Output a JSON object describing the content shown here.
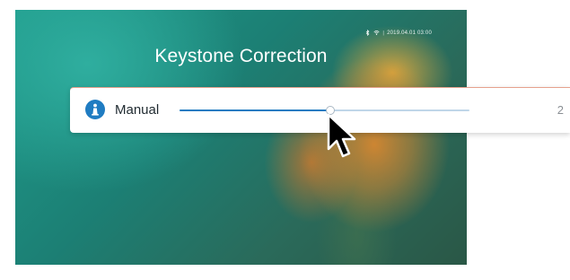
{
  "status_bar": {
    "bluetooth_icon": "bluetooth-icon",
    "wifi_icon": "wifi-icon",
    "separator": "|",
    "datetime": "2019.04.01 03:00"
  },
  "title": "Keystone Correction",
  "panel": {
    "mode_icon": "keystone-icon",
    "mode_label": "Manual",
    "slider": {
      "level": 0.52
    },
    "value": "2"
  },
  "colors": {
    "accent": "#1f7cc2",
    "track": "#bfd6e8",
    "title_text": "#ffffff"
  },
  "cursor_icon": "mouse-pointer-icon"
}
